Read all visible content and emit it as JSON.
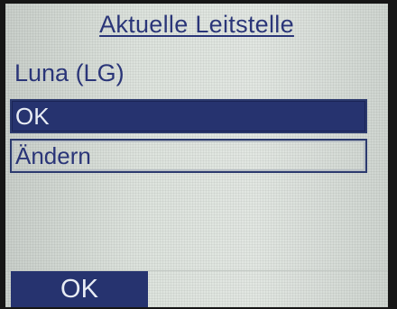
{
  "screen": {
    "title": "Aktuelle Leitstelle",
    "current_value": "Luna (LG)"
  },
  "menu": {
    "items": [
      {
        "label": "OK",
        "selected": true
      },
      {
        "label": "Ändern",
        "selected": false
      }
    ]
  },
  "softkeys": {
    "left_label": "OK"
  },
  "colors": {
    "accent": "#26336f",
    "text": "#2a3578",
    "screen_background": "#d6dcd6"
  }
}
